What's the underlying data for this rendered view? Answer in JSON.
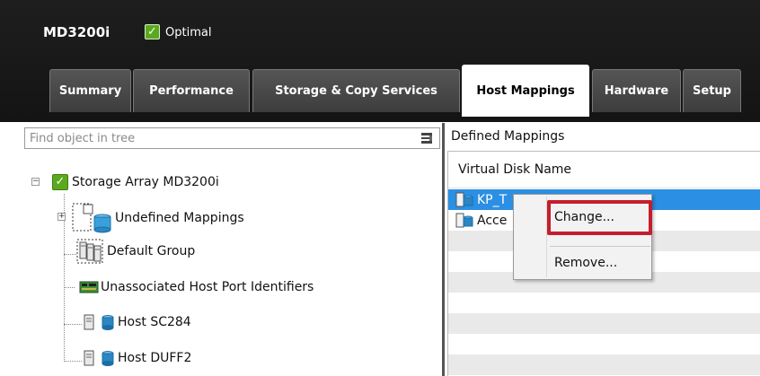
{
  "header": {
    "array_name": "MD3200i",
    "status": "Optimal"
  },
  "tabs": [
    {
      "label": "Summary",
      "active": false
    },
    {
      "label": "Performance",
      "active": false
    },
    {
      "label": "Storage & Copy Services",
      "active": false
    },
    {
      "label": "Host Mappings",
      "active": true
    },
    {
      "label": "Hardware",
      "active": false
    },
    {
      "label": "Setup",
      "active": false
    }
  ],
  "tree": {
    "search_placeholder": "Find object in tree",
    "nodes": [
      {
        "label": "Storage Array MD3200i",
        "icon": "check-icon"
      },
      {
        "label": "Undefined Mappings",
        "icon": "undefined-mappings-icon"
      },
      {
        "label": "Default Group",
        "icon": "host-group-icon"
      },
      {
        "label": "Unassociated Host Port Identifiers",
        "icon": "port-card-icon"
      },
      {
        "label": "Host SC284",
        "icon": "host-icon"
      },
      {
        "label": "Host DUFF2",
        "icon": "host-icon"
      }
    ]
  },
  "mappings": {
    "title": "Defined Mappings",
    "column_header": "Virtual Disk Name",
    "rows": [
      {
        "name": "KP_T",
        "selected": true
      },
      {
        "name": "Acce",
        "selected": false
      }
    ]
  },
  "context_menu": {
    "items": [
      {
        "label": "Change..."
      },
      {
        "label": "Remove..."
      }
    ]
  },
  "colors": {
    "selection": "#2b8fe3",
    "highlight": "#c41e2e",
    "status_ok": "#5aa91f"
  }
}
